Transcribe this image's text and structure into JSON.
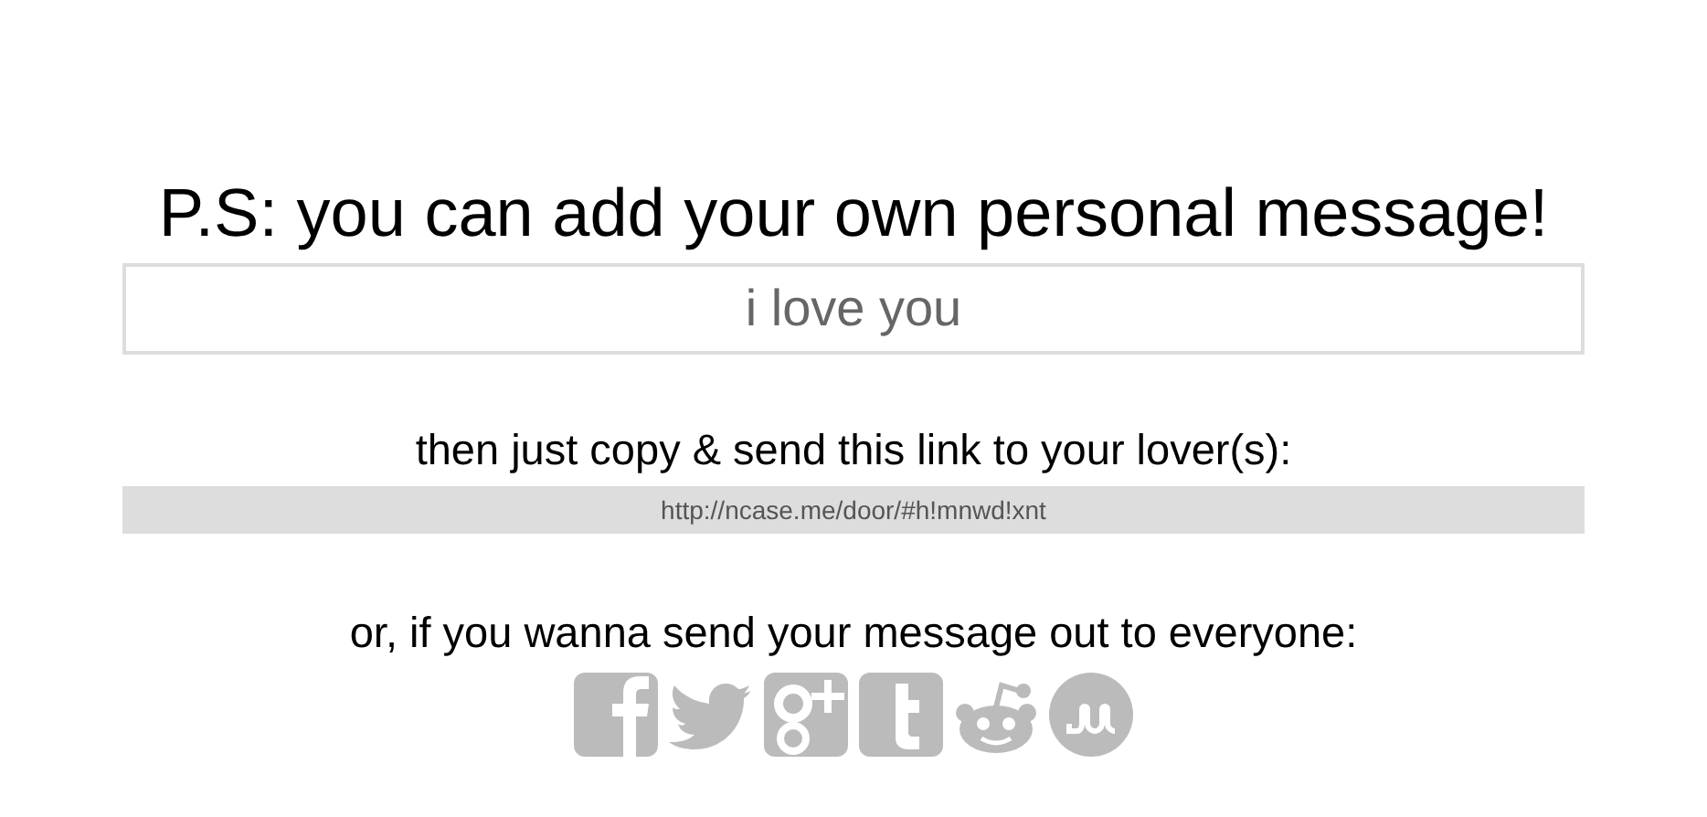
{
  "heading": "P.S: you can add your own personal message!",
  "message_field": {
    "value": "i love you"
  },
  "link_prompt": "then just copy & send this link to your lover(s):",
  "link": "http://ncase.me/door/#h!mnwd!xnt",
  "share_prompt": "or, if you wanna send your message out to everyone:",
  "share_buttons": [
    {
      "kind": "f"
    },
    {
      "kind": "bird"
    },
    {
      "kind": "gplus"
    },
    {
      "kind": "t"
    },
    {
      "kind": "robot"
    },
    {
      "kind": "su"
    }
  ]
}
